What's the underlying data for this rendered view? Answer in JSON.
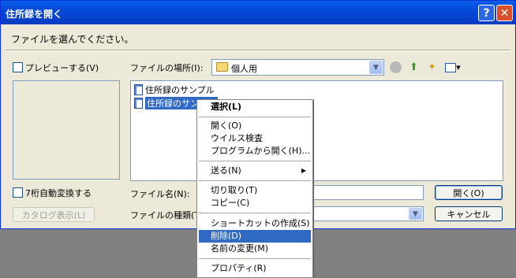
{
  "window": {
    "title": "住所録を開く",
    "help_glyph": "?",
    "close_glyph": "✕"
  },
  "instruction": "ファイルを選んでください。",
  "preview_checkbox_label": "プレビューする(V)",
  "lookin": {
    "label": "ファイルの場所(I):",
    "value": "個人用"
  },
  "files": [
    {
      "name": "住所録のサンプル",
      "selected": false
    },
    {
      "name": "住所録のサンプル",
      "selected": true
    }
  ],
  "zip_checkbox_label": "7桁自動変換する",
  "catalog_button": "カタログ表示(L)",
  "filename": {
    "label": "ファイル名(N):",
    "value": ""
  },
  "filetype": {
    "label": "ファイルの種類(T):",
    "value": ""
  },
  "buttons": {
    "open": "開く(O)",
    "cancel": "キャンセル"
  },
  "context_menu": [
    {
      "label": "選択(L)",
      "bold": true
    },
    {
      "sep": true
    },
    {
      "label": "開く(O)"
    },
    {
      "label": "ウイルス検査"
    },
    {
      "label": "プログラムから開く(H)..."
    },
    {
      "sep": true
    },
    {
      "label": "送る(N)",
      "submenu": true
    },
    {
      "sep": true
    },
    {
      "label": "切り取り(T)"
    },
    {
      "label": "コピー(C)"
    },
    {
      "sep": true
    },
    {
      "label": "ショートカットの作成(S)"
    },
    {
      "label": "削除(D)",
      "highlighted": true
    },
    {
      "label": "名前の変更(M)"
    },
    {
      "sep": true
    },
    {
      "label": "プロパティ(R)"
    }
  ],
  "colors": {
    "selection": "#316ac5",
    "titlebar": "#0346d6",
    "face": "#ece9d8"
  },
  "icons": [
    "folder-icon",
    "back-icon",
    "up-folder-icon",
    "new-folder-icon",
    "view-menu-icon",
    "document-icon",
    "submenu-arrow-icon"
  ]
}
